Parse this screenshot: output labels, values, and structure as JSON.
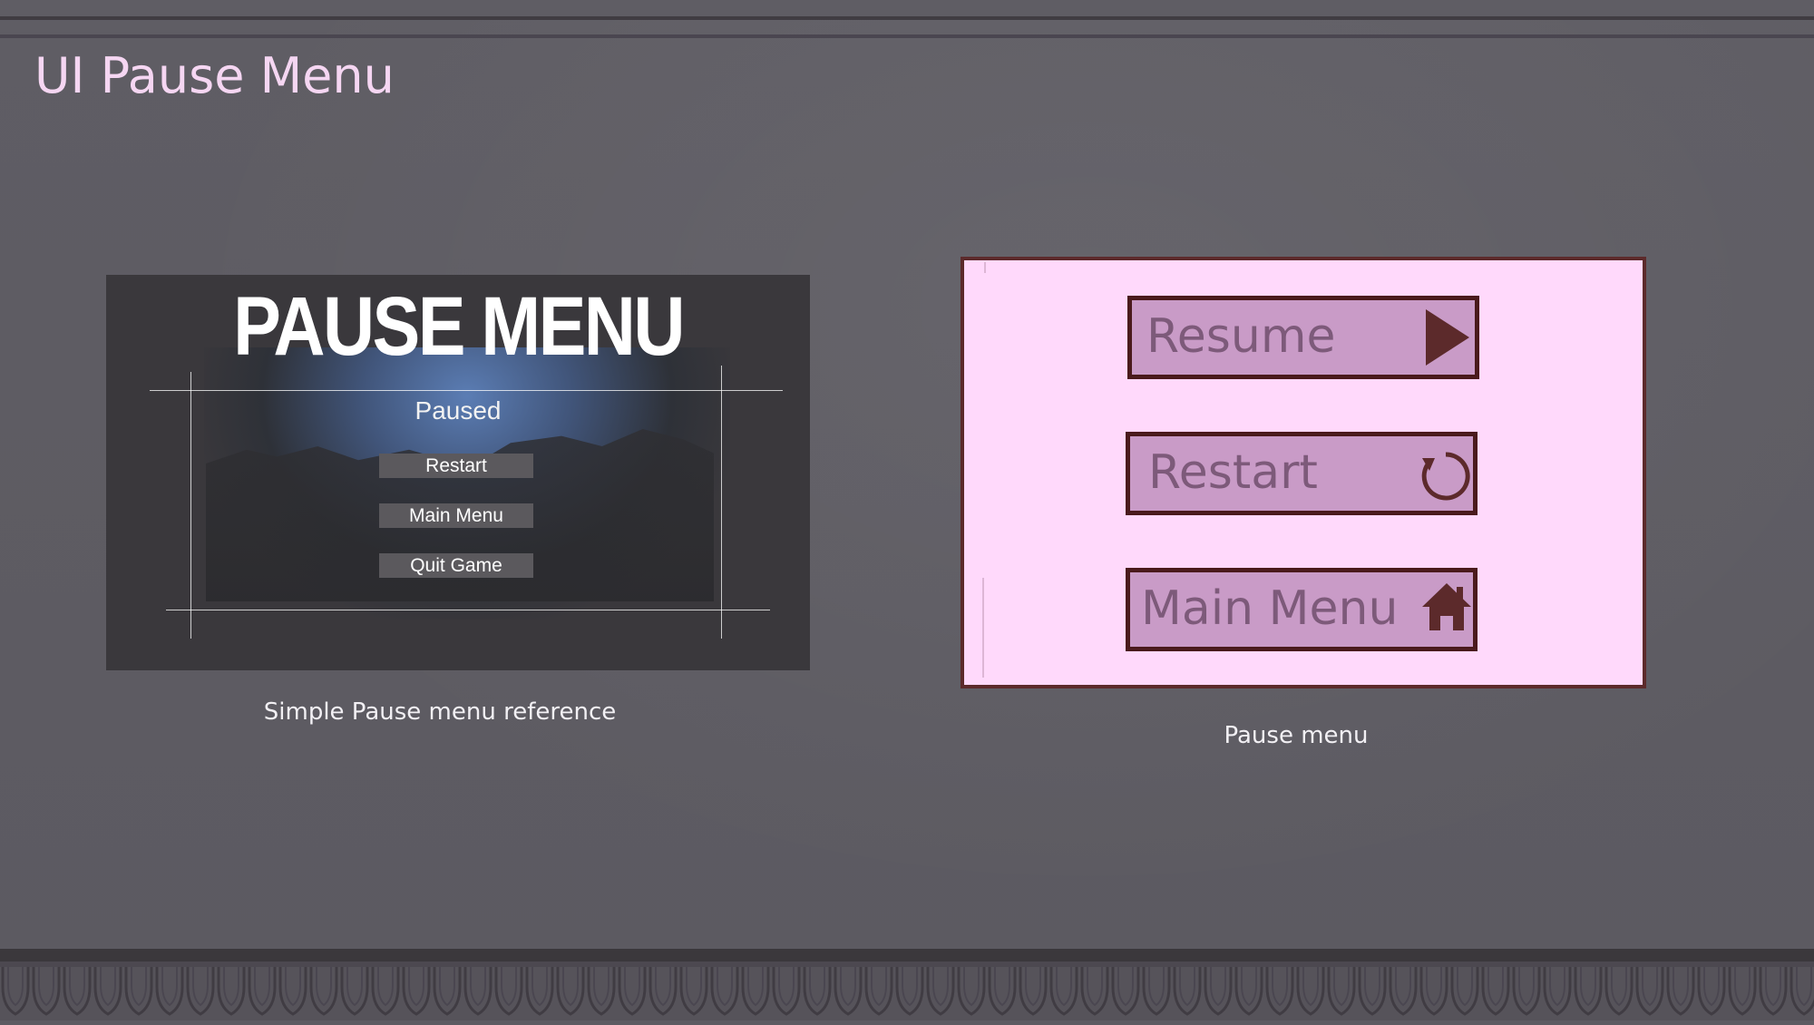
{
  "slide": {
    "title": "UI Pause Menu"
  },
  "reference": {
    "heading": "PAUSE MENU",
    "paused_label": "Paused",
    "buttons": [
      "Restart",
      "Main Menu",
      "Quit Game"
    ],
    "caption": "Simple Pause menu reference"
  },
  "design": {
    "buttons": [
      {
        "label": "Resume",
        "icon": "play-icon"
      },
      {
        "label": "Restart",
        "icon": "restart-icon"
      },
      {
        "label": "Main Menu",
        "icon": "home-icon"
      }
    ],
    "caption": "Pause menu",
    "colors": {
      "panel_bg": "#ffd9fb",
      "panel_border": "#5c2a2b",
      "button_bg": "#c99bc7",
      "button_border": "#4a1a1c",
      "icon": "#5c2a2b"
    }
  }
}
